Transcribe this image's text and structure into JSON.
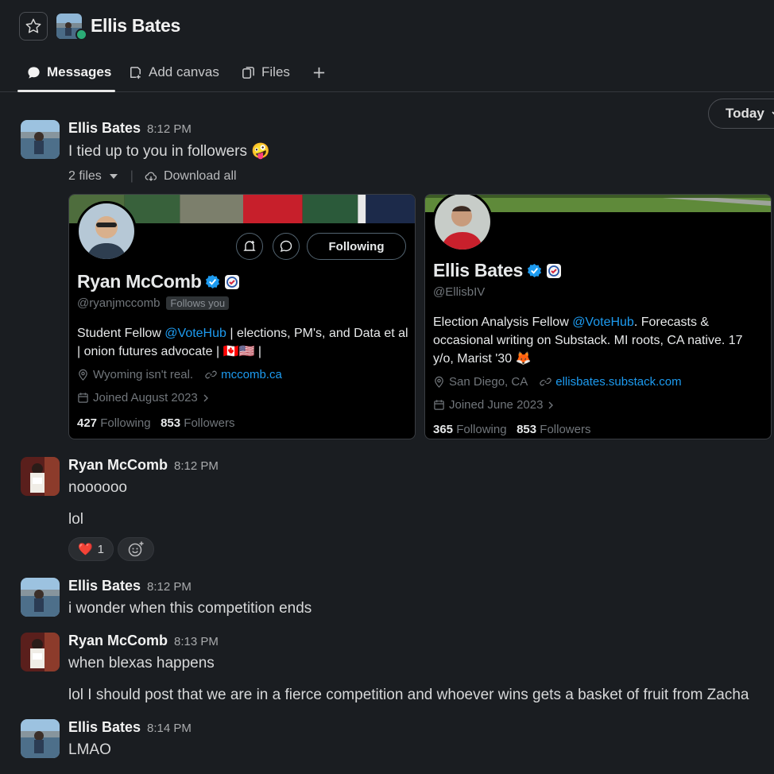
{
  "header": {
    "title": "Ellis Bates",
    "tabs": [
      {
        "label": "Messages",
        "icon": "message-bubble-icon"
      },
      {
        "label": "Add canvas",
        "icon": "canvas-icon"
      },
      {
        "label": "Files",
        "icon": "files-icon"
      }
    ],
    "add_tab_icon": "plus-icon"
  },
  "date_pill": {
    "label": "Today"
  },
  "messages": [
    {
      "sender": "Ellis Bates",
      "time": "8:12 PM",
      "text": "I tied up to you in followers",
      "emoji": "🤪"
    },
    {
      "sender": "Ryan McComb",
      "time": "8:12 PM",
      "lines": [
        "noooooo",
        "lol"
      ]
    },
    {
      "sender": "Ellis Bates",
      "time": "8:12 PM",
      "text": "i wonder when this competition ends"
    },
    {
      "sender": "Ryan McComb",
      "time": "8:13 PM",
      "lines": [
        "when blexas happens",
        "lol I should post that we are in a fierce competition and whoever wins gets a basket of fruit from Zacha"
      ]
    },
    {
      "sender": "Ellis Bates",
      "time": "8:14 PM",
      "text": "LMAO"
    }
  ],
  "attachments": {
    "count_label": "2 files",
    "download_label": "Download all"
  },
  "cards": [
    {
      "name": "Ryan McComb",
      "handle": "@ryanjmccomb",
      "follows_you": "Follows you",
      "follow_button": "Following",
      "bio_pre": "Student Fellow ",
      "bio_link": "@VoteHub",
      "bio_post": " | elections, PM's, and Data et al | onion futures advocate | 🇨🇦🇺🇸 |",
      "location": "Wyoming isn't real.",
      "website": "mccomb.ca",
      "joined": "Joined August 2023",
      "following_count": "427",
      "following_label": "Following",
      "followers_count": "853",
      "followers_label": "Followers"
    },
    {
      "name": "Ellis Bates",
      "handle": "@EllisbIV",
      "bio_pre": "Election Analysis Fellow ",
      "bio_link": "@VoteHub",
      "bio_post": ". Forecasts & occasional writing on Substack. MI roots, CA native. 17 y/o, Marist '30 🦊",
      "location": "San Diego, CA",
      "website": "ellisbates.substack.com",
      "joined": "Joined June 2023",
      "following_count": "365",
      "following_label": "Following",
      "followers_count": "853",
      "followers_label": "Followers"
    }
  ],
  "reactions": [
    {
      "emoji": "❤️",
      "count": "1"
    }
  ],
  "colors": {
    "background": "#1a1d21",
    "link": "#1d9bf0",
    "presence": "#2bac76"
  }
}
